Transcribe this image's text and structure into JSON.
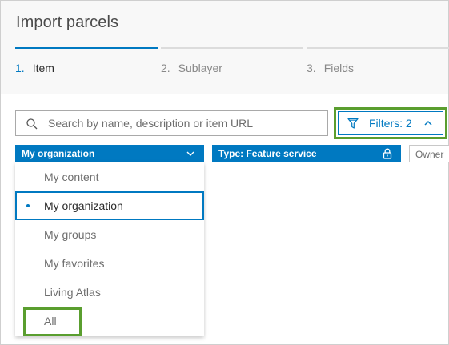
{
  "dialog": {
    "title": "Import parcels"
  },
  "steps": [
    {
      "num": "1.",
      "label": "Item"
    },
    {
      "num": "2.",
      "label": "Sublayer"
    },
    {
      "num": "3.",
      "label": "Fields"
    }
  ],
  "search": {
    "placeholder": "Search by name, description or item URL",
    "value": ""
  },
  "filters": {
    "label": "Filters: 2"
  },
  "chips": {
    "scope": "My organization",
    "type": "Type: Feature service",
    "owner": "Owner"
  },
  "menu": {
    "items": [
      {
        "label": "My content"
      },
      {
        "label": "My organization"
      },
      {
        "label": "My groups"
      },
      {
        "label": "My favorites"
      },
      {
        "label": "Living Atlas"
      },
      {
        "label": "All"
      }
    ],
    "selected": "My organization"
  },
  "colors": {
    "accent": "#0079c1",
    "highlight": "#5a9e2f"
  }
}
